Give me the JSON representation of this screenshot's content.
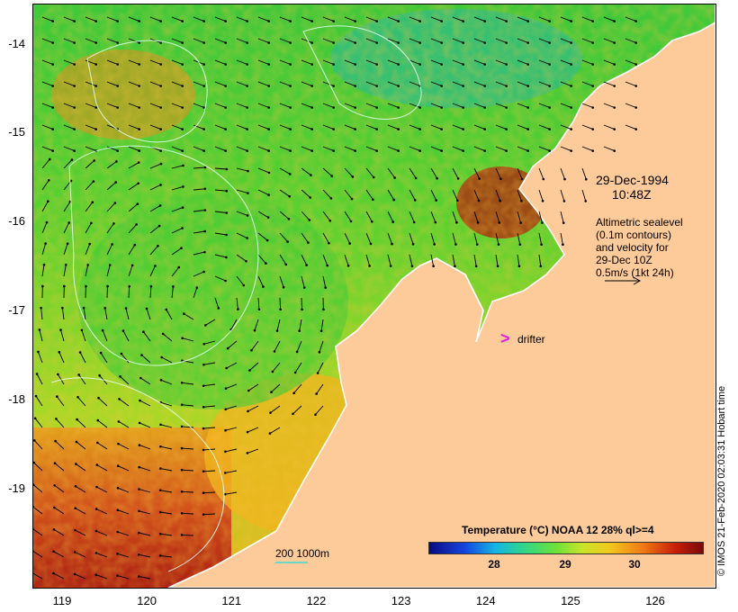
{
  "map": {
    "date": "29-Dec-1994",
    "time": "10:48Z",
    "legend_lines": [
      "Altimetric sealevel",
      "(0.1m contours)",
      "and velocity for",
      "29-Dec 10Z",
      "0.5m/s (1kt 24h)"
    ],
    "drifter_symbol": ">",
    "drifter_label": "drifter",
    "scale_label": "200  1000m",
    "colorbar_title": "Temperature (°C) NOAA 12 28% ql>=4",
    "colorbar_ticks": [
      "28",
      "29",
      "30"
    ],
    "credit": "© IMOS 21-Feb-2020 02:03:31 Hobart time",
    "y_ticks": [
      "-14",
      "-15",
      "-16",
      "-17",
      "-18",
      "-19"
    ],
    "x_ticks": [
      "119",
      "120",
      "121",
      "122",
      "123",
      "124",
      "125",
      "126"
    ],
    "lon_range": [
      118.65,
      126.7
    ],
    "lat_range": [
      -20.1,
      -13.55
    ],
    "colors": {
      "land": "#fdcb9a",
      "coast": "#ffffff",
      "arrow": "#000000",
      "contour": "#e6fff6",
      "drifter": "#e11ee1",
      "isobath": "#6cd6c8"
    }
  }
}
